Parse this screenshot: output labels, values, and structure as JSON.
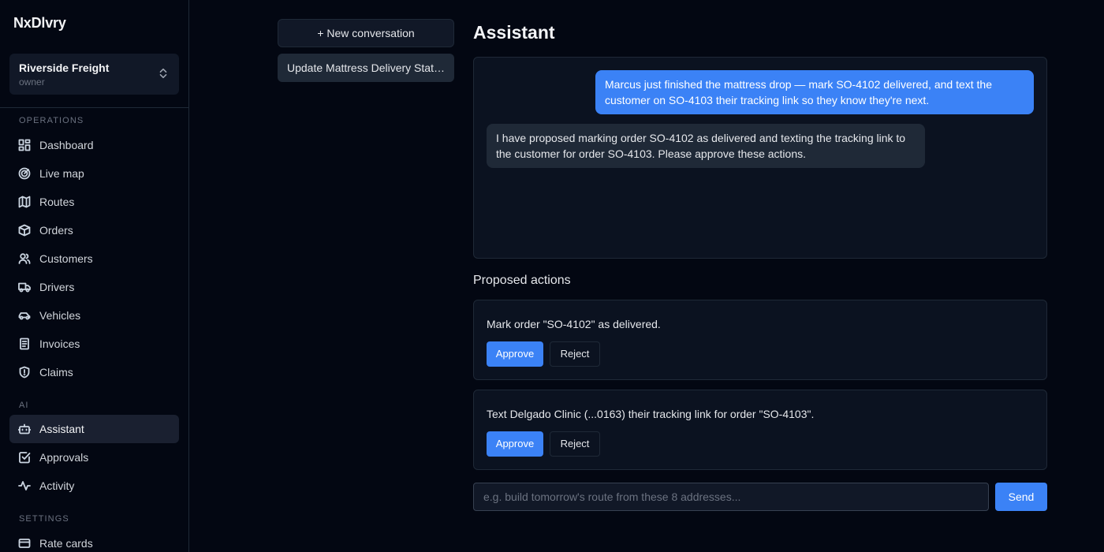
{
  "brand": "NxDlvry",
  "org": {
    "name": "Riverside Freight",
    "role": "owner"
  },
  "sections": {
    "operations": "OPERATIONS",
    "ai": "AI",
    "settings": "SETTINGS"
  },
  "nav": {
    "dashboard": "Dashboard",
    "live_map": "Live map",
    "routes": "Routes",
    "orders": "Orders",
    "customers": "Customers",
    "drivers": "Drivers",
    "vehicles": "Vehicles",
    "invoices": "Invoices",
    "claims": "Claims",
    "assistant": "Assistant",
    "approvals": "Approvals",
    "activity": "Activity",
    "rate_cards": "Rate cards"
  },
  "conversations": {
    "new_label": "+ New conversation",
    "items": [
      "Update Mattress Delivery Status"
    ]
  },
  "main": {
    "title": "Assistant",
    "messages": {
      "user": "Marcus just finished the mattress drop — mark SO-4102 delivered, and text the customer on SO-4103 their tracking link so they know they're next.",
      "assistant": "I have proposed marking order SO-4102 as delivered and texting the tracking link to the customer for order SO-4103. Please approve these actions."
    },
    "actions_title": "Proposed actions",
    "actions": [
      {
        "text": "Mark order \"SO-4102\" as delivered.",
        "approve": "Approve",
        "reject": "Reject"
      },
      {
        "text": "Text Delgado Clinic (...0163) their tracking link for order \"SO-4103\".",
        "approve": "Approve",
        "reject": "Reject"
      }
    ],
    "input_placeholder": "e.g. build tomorrow's route from these 8 addresses...",
    "send_label": "Send"
  },
  "colors": {
    "accent": "#3b82f6",
    "background": "#030712",
    "panel": "#0b1220",
    "border": "#1f2937"
  }
}
